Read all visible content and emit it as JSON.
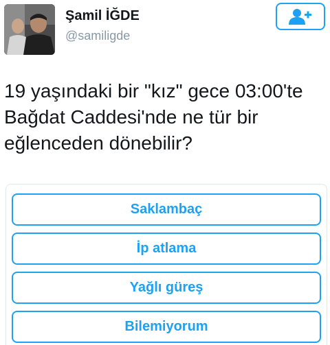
{
  "tweet": {
    "author": {
      "display_name": "Şamil İĞDE",
      "handle": "@samiligde"
    },
    "follow_icon": "add-user-icon",
    "text": "19 yaşındaki bir \"kız\" gece 03:00'te\nBağdat Caddesi'nde ne tür bir\neğlenceden dönebilir?",
    "poll": {
      "options": [
        {
          "label": "Saklambaç"
        },
        {
          "label": "İp atlama"
        },
        {
          "label": "Yağlı güreş"
        },
        {
          "label": "Bilemiyorum"
        }
      ]
    }
  },
  "colors": {
    "accent": "#1da1f2",
    "name_text": "#14171a",
    "handle_text": "#8899a6"
  }
}
